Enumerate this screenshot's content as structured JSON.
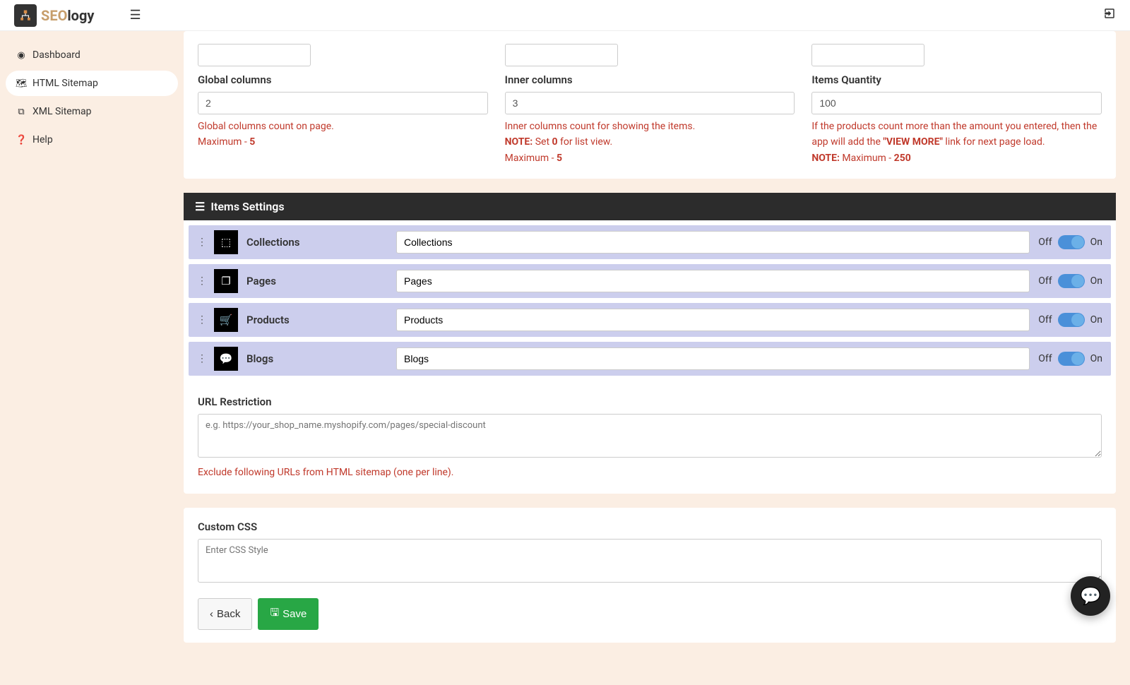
{
  "brand": {
    "seo": "SEO",
    "logy": "logy"
  },
  "sidebar": {
    "items": [
      {
        "label": "Dashboard"
      },
      {
        "label": "HTML Sitemap"
      },
      {
        "label": "XML Sitemap"
      },
      {
        "label": "Help"
      }
    ]
  },
  "columns": {
    "global": {
      "label": "Global columns",
      "value": "2",
      "note1": "Global columns count on page.",
      "note2_pre": "Maximum - ",
      "note2_b": "5"
    },
    "inner": {
      "label": "Inner columns",
      "value": "3",
      "note1": "Inner columns count for showing the items.",
      "note2_label": "NOTE:",
      "note2_pre": " Set ",
      "note2_b": "0",
      "note2_post": " for list view.",
      "note3_pre": "Maximum - ",
      "note3_b": "5"
    },
    "qty": {
      "label": "Items Quantity",
      "value": "100",
      "note1": "If the products count more than the amount you entered, then the app will add the ",
      "note1_b": "\"VIEW MORE\"",
      "note1_post": " link for next page load.",
      "note2_label": "NOTE:",
      "note2_pre": " Maximum - ",
      "note2_b": "250"
    }
  },
  "items_settings": {
    "header": "Items Settings",
    "off": "Off",
    "on": "On",
    "rows": [
      {
        "title": "Collections",
        "value": "Collections"
      },
      {
        "title": "Pages",
        "value": "Pages"
      },
      {
        "title": "Products",
        "value": "Products"
      },
      {
        "title": "Blogs",
        "value": "Blogs"
      }
    ]
  },
  "url_restriction": {
    "label": "URL Restriction",
    "placeholder": "e.g. https://your_shop_name.myshopify.com/pages/special-discount",
    "note": "Exclude following URLs from HTML sitemap (one per line)."
  },
  "custom_css": {
    "label": "Custom CSS",
    "placeholder": "Enter CSS Style"
  },
  "actions": {
    "back": "Back",
    "save": "Save"
  }
}
